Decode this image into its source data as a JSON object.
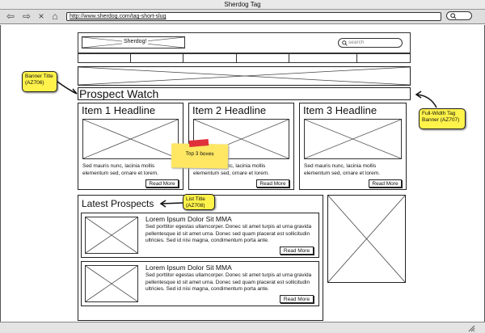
{
  "window": {
    "title": "Sherdog Tag"
  },
  "browser": {
    "url": "http://www.sherdog.com/tag-short-slug",
    "back_icon": "⇦",
    "forward_icon": "⇨",
    "close_icon": "×",
    "home_icon": "⌂"
  },
  "site": {
    "logo_label": "Sherdog!",
    "search_placeholder": "search"
  },
  "banner": {
    "title": "Prospect Watch"
  },
  "items": [
    {
      "headline": "Item 1 Headline",
      "text": "Sed mauris nunc, lacinia mollis elementum sed, ornare et lorem.",
      "read_more": "Read More"
    },
    {
      "headline": "Item 2 Headline",
      "text": "Sed mauris nunc, lacinia mollis elementum sed, ornare et lorem.",
      "read_more": "Read More"
    },
    {
      "headline": "Item 3 Headline",
      "text": "Sed mauris nunc, lacinia mollis elementum sed, ornare et lorem.",
      "read_more": "Read More"
    }
  ],
  "latest": {
    "title": "Latest Prospects",
    "entries": [
      {
        "headline": "Lorem Ipsum Dolor Sit MMA",
        "text": "Sed porttitor egestas ullamcorper. Donec sit amet turpis at urna gravida pellentesque id sit amet urna. Donec sed quam placerat est sollicitudin ultricies. Sed id nisi magna, condimentum porta ante.",
        "read_more": "Read More"
      },
      {
        "headline": "Lorem Ipsum Dolor Sit MMA",
        "text": "Sed porttitor egestas ullamcorper. Donec sit amet turpis at urna gravida pellentesque id sit amet urna. Donec sed quam placerat est sollicitudin ultricies. Sed id nisi magna, condimentum porta ante.",
        "read_more": "Read More"
      }
    ]
  },
  "annotations": {
    "banner_title": "Banner Title (AZ706)",
    "full_width": "Full-Width Tag Banner (AZ707)",
    "list_title": "List Title (AZ708)",
    "top3": "Top 3 boxes"
  },
  "colors": {
    "note_yellow": "#fff24a",
    "sticky_yellow": "#ffe763",
    "pin_red": "#e0303a"
  }
}
